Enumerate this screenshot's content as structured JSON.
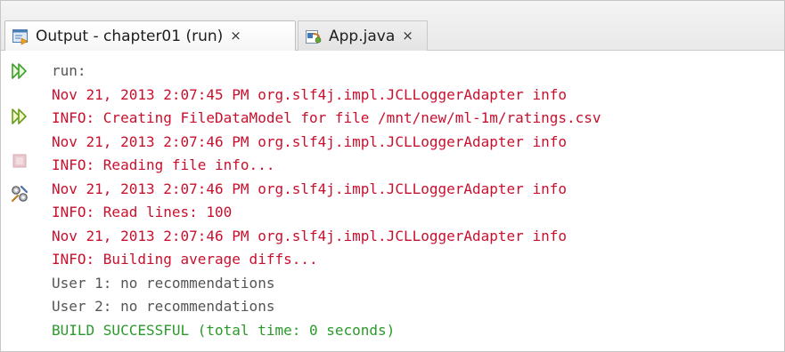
{
  "tabs": {
    "output": {
      "label": "Output - chapter01 (run)",
      "close": "×",
      "icon": "output-window-icon"
    },
    "app": {
      "label": "App.java",
      "close": "×",
      "icon": "java-file-icon"
    }
  },
  "toolbar": {
    "rerun": "rerun-icon",
    "rerun_with_options": "rerun-with-options-icon",
    "stop": "stop-icon",
    "settings": "settings-icon"
  },
  "colors": {
    "stderr": "#c8102e",
    "stdout": "#555555",
    "success": "#2a9a2a",
    "run_arrow": "#2f9e2f"
  },
  "console": {
    "lines": [
      {
        "text": "run:",
        "type": "out"
      },
      {
        "text": "Nov 21, 2013 2:07:45 PM org.slf4j.impl.JCLLoggerAdapter info",
        "type": "err"
      },
      {
        "text": "INFO: Creating FileDataModel for file /mnt/new/ml-1m/ratings.csv",
        "type": "err"
      },
      {
        "text": "Nov 21, 2013 2:07:46 PM org.slf4j.impl.JCLLoggerAdapter info",
        "type": "err"
      },
      {
        "text": "INFO: Reading file info...",
        "type": "err"
      },
      {
        "text": "Nov 21, 2013 2:07:46 PM org.slf4j.impl.JCLLoggerAdapter info",
        "type": "err"
      },
      {
        "text": "INFO: Read lines: 100",
        "type": "err"
      },
      {
        "text": "Nov 21, 2013 2:07:46 PM org.slf4j.impl.JCLLoggerAdapter info",
        "type": "err"
      },
      {
        "text": "INFO: Building average diffs...",
        "type": "err"
      },
      {
        "text": "User 1: no recommendations",
        "type": "out"
      },
      {
        "text": "User 2: no recommendations",
        "type": "out"
      },
      {
        "text": "BUILD SUCCESSFUL (total time: 0 seconds)",
        "type": "ok"
      }
    ]
  }
}
